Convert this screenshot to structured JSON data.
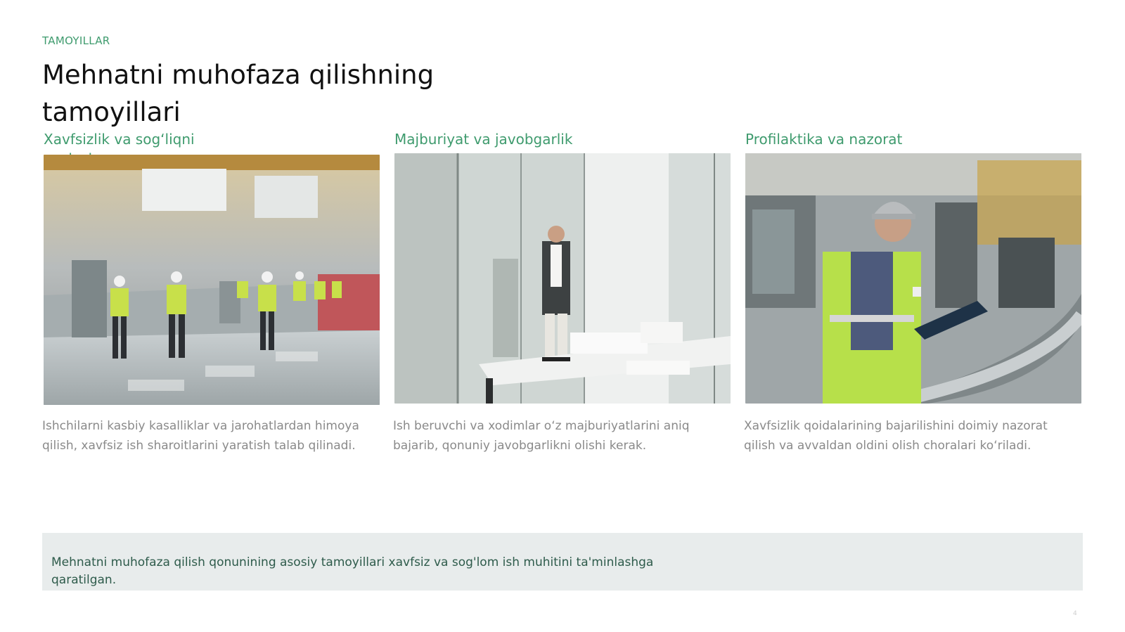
{
  "header": {
    "kicker": "TAMOYILLAR",
    "title": "Mehnatni muhofaza qilishning tamoyillari"
  },
  "columns": [
    {
      "title": "Xavfsizlik va sog‘liqni saqlash",
      "image_icon": "factory-workers-photo",
      "description": "Ishchilarni kasbiy kasalliklar va jarohatlardan himoya qilish, xavfsiz ish sharoitlarini yaratish talab qilinadi."
    },
    {
      "title": "Majburiyat va javobgarlik",
      "image_icon": "office-manager-photo",
      "description": "Ish beruvchi va xodimlar o‘z majburiyatlarini aniq bajarib, qonuniy javobgarlikni olishi kerak."
    },
    {
      "title": "Profilaktika va nazorat",
      "image_icon": "inspector-tablet-photo",
      "description": "Xavfsizlik qoidalarining bajarilishini doimiy nazorat qilish va avvaldan oldini olish choralari ko‘riladi."
    }
  ],
  "callout": {
    "text": "Mehnatni muhofaza qilish qonunining asosiy tamoyillari xavfsiz va sog'lom ish muhitini ta'minlashga qaratilgan."
  },
  "footer": {
    "page_number": "4"
  },
  "colors": {
    "accent": "#3f9b6e",
    "callout_bg": "#e8ecec"
  }
}
